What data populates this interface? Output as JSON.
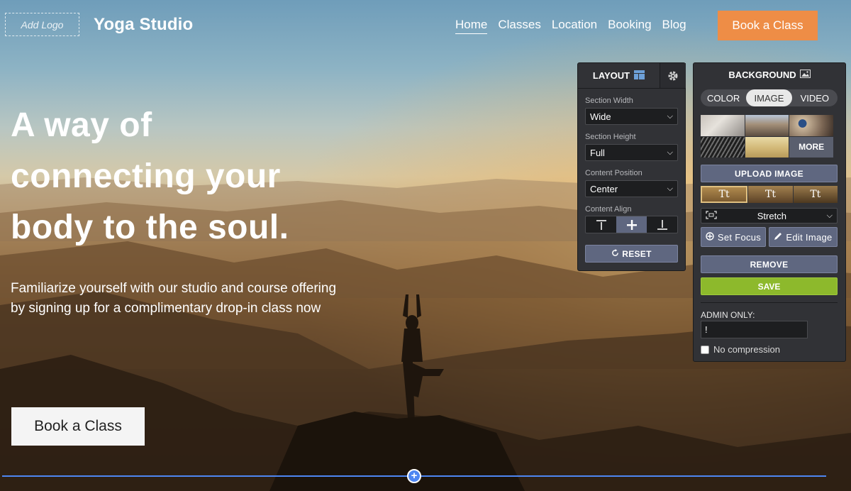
{
  "header": {
    "logo_placeholder": "Add Logo",
    "brand": "Yoga Studio",
    "nav": [
      {
        "label": "Home",
        "active": true
      },
      {
        "label": "Classes"
      },
      {
        "label": "Location"
      },
      {
        "label": "Booking"
      },
      {
        "label": "Blog"
      }
    ],
    "cta": "Book a Class"
  },
  "hero": {
    "headline_lines": [
      "A way of",
      "connecting your",
      "body to the soul."
    ],
    "subhead": "Familiarize yourself with our studio and course offering by signing up for a complimentary drop-in class now",
    "cta": "Book a Class"
  },
  "layout_panel": {
    "title": "LAYOUT",
    "fields": [
      {
        "label": "Section Width",
        "value": "Wide"
      },
      {
        "label": "Section Height",
        "value": "Full"
      },
      {
        "label": "Content Position",
        "value": "Center"
      }
    ],
    "content_align_label": "Content Align",
    "content_align_selected": "center",
    "reset_label": "RESET"
  },
  "background_panel": {
    "title": "BACKGROUND",
    "tabs": [
      {
        "label": "COLOR"
      },
      {
        "label": "IMAGE",
        "active": true
      },
      {
        "label": "VIDEO"
      }
    ],
    "more_label": "MORE",
    "upload_label": "UPLOAD IMAGE",
    "text_style_sample": "Tt",
    "fit_value": "Stretch",
    "set_focus_label": "Set Focus",
    "edit_image_label": "Edit Image",
    "remove_label": "REMOVE",
    "save_label": "SAVE",
    "admin_label": "ADMIN ONLY:",
    "admin_value": "!",
    "no_compression_label": "No compression"
  },
  "colors": {
    "accent_orange": "#ee8d46",
    "save_green": "#8db92c",
    "panel_bg": "#313236",
    "button_slate": "#5f6780",
    "section_divider": "#4d86f2"
  },
  "icons": [
    "layout-icon",
    "gear-icon",
    "image-icon",
    "align-top-icon",
    "align-center-icon",
    "align-bottom-icon",
    "reset-icon",
    "fit-icon",
    "chevron-down-icon",
    "focus-icon",
    "pencil-icon",
    "add-section-icon"
  ]
}
